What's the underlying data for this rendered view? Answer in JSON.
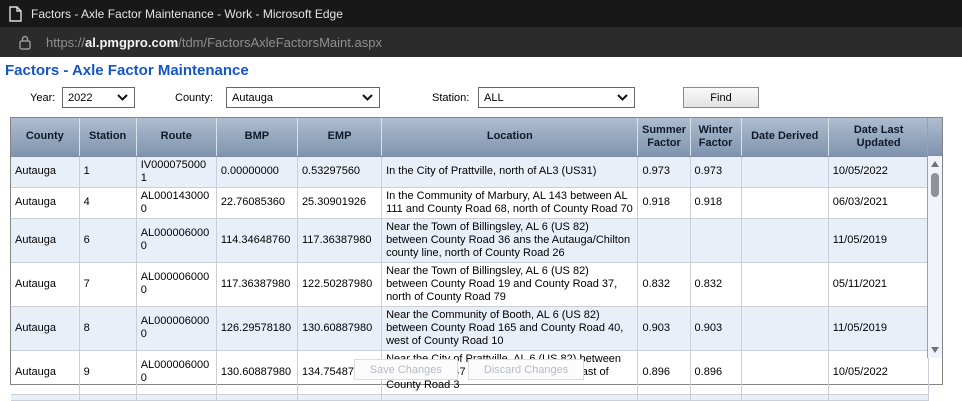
{
  "window": {
    "title": "Factors - Axle Factor Maintenance - Work - Microsoft Edge",
    "url_scheme": "https://",
    "url_domain": "al.pmgpro.com",
    "url_path": "/tdm/FactorsAxleFactorsMaint.aspx"
  },
  "page": {
    "heading": "Factors - Axle Factor Maintenance"
  },
  "filters": {
    "year_label": "Year:",
    "year_value": "2022",
    "county_label": "County:",
    "county_value": "Autauga",
    "station_label": "Station:",
    "station_value": "ALL",
    "find_label": "Find"
  },
  "table": {
    "headers": [
      "County",
      "Station",
      "Route",
      "BMP",
      "EMP",
      "Location",
      "Summer Factor",
      "Winter Factor",
      "Date Derived",
      "Date Last Updated"
    ],
    "rows": [
      [
        "Autauga",
        "1",
        "IV0000750001",
        "0.00000000",
        "0.53297560",
        "In the City of Prattville, north of AL3 (US31)",
        "0.973",
        "0.973",
        "",
        "10/05/2022"
      ],
      [
        "Autauga",
        "4",
        "AL0001430000",
        "22.76085360",
        "25.30901926",
        "In the Community of Marbury, AL 143 between AL 111 and County Road 68, north of County Road 70",
        "0.918",
        "0.918",
        "",
        "06/03/2021"
      ],
      [
        "Autauga",
        "6",
        "AL0000060000",
        "114.34648760",
        "117.36387980",
        "Near the Town of Billingsley, AL 6 (US 82) between County Road 36 ans the Autauga/Chilton county line, north of County Road 26",
        "",
        "",
        "",
        "11/05/2019"
      ],
      [
        "Autauga",
        "7",
        "AL0000060000",
        "117.36387980",
        "122.50287980",
        "Near the Town of Billingsley, AL 6 (US 82) between County Road 19 and County Road 37, north of County Road 79",
        "0.832",
        "0.832",
        "",
        "05/11/2021"
      ],
      [
        "Autauga",
        "8",
        "AL0000060000",
        "126.29578180",
        "130.60887980",
        "Near the Community of Booth, AL 6 (US 82) between County Road 165 and County Road 40, west of County Road 10",
        "0.903",
        "0.903",
        "",
        "11/05/2019"
      ],
      [
        "Autauga",
        "9",
        "AL0000060000",
        "130.60887980",
        "134.75487980",
        "Near the City of Prattville, AL 6 (US 82) between County Road 47 and County Road 10, east of County Road 3",
        "0.896",
        "0.896",
        "",
        "10/05/2022"
      ]
    ]
  },
  "actions": {
    "save_label": "Save Changes",
    "discard_label": "Discard Changes"
  },
  "colors": {
    "accent_blue": "#1656C4",
    "titlebar_bg": "#181818",
    "urlbar_bg": "#2b2b2b",
    "header_grad_top": "#aebdd0",
    "header_grad_bottom": "#7f94ad",
    "row_alt": "#E9EFF9"
  }
}
